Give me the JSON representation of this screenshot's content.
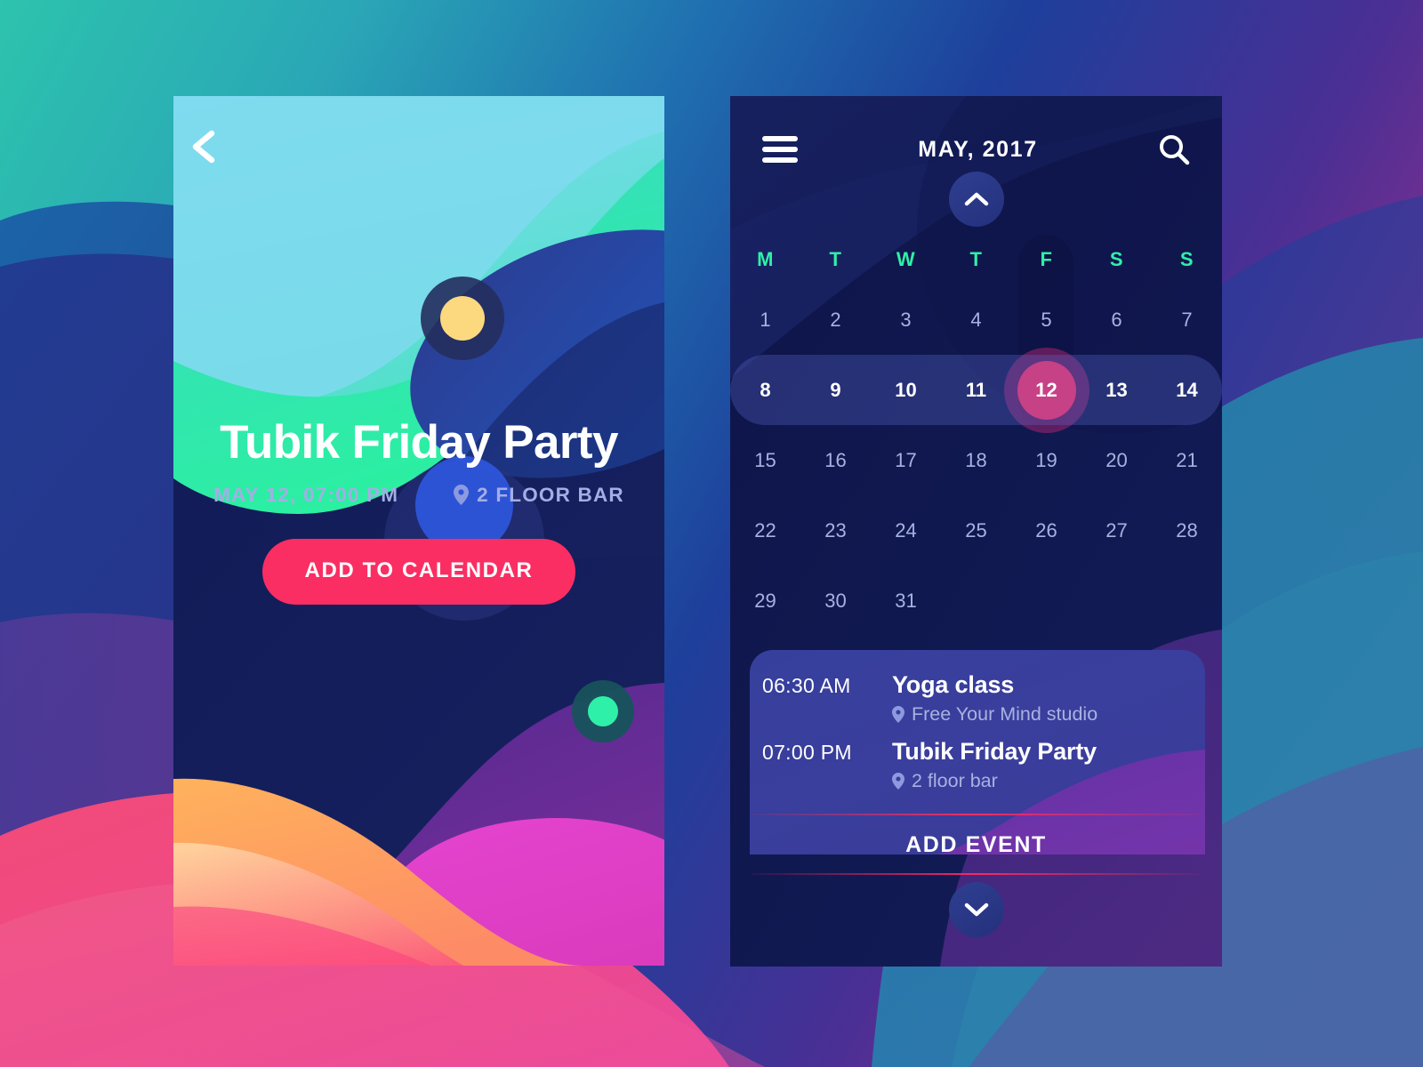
{
  "theme": {
    "accent_pink": "#fa2e63",
    "mint": "#2ff0a8",
    "card_navy": "#141c56",
    "muted_text": "#a8b2e0",
    "panel_blue": "#3a3e9c"
  },
  "event_screen": {
    "back_icon": "chevron-left-icon",
    "title": "Tubik Friday Party",
    "datetime": "MAY 12, 07:00 PM",
    "location_icon": "map-pin-icon",
    "location": "2 FLOOR BAR",
    "cta_label": "ADD TO CALENDAR"
  },
  "calendar_screen": {
    "menu_icon": "hamburger-menu-icon",
    "month_label": "MAY, 2017",
    "search_icon": "search-icon",
    "collapse_icon": "chevron-up-icon",
    "expand_icon": "chevron-down-icon",
    "weekday_headers": [
      "M",
      "T",
      "W",
      "T",
      "F",
      "S",
      "S"
    ],
    "highlighted_weekday_index": 4,
    "weeks": [
      [
        "1",
        "2",
        "3",
        "4",
        "5",
        "6",
        "7"
      ],
      [
        "8",
        "9",
        "10",
        "11",
        "12",
        "13",
        "14"
      ],
      [
        "15",
        "16",
        "17",
        "18",
        "19",
        "20",
        "21"
      ],
      [
        "22",
        "23",
        "24",
        "25",
        "26",
        "27",
        "28"
      ],
      [
        "29",
        "30",
        "31",
        "",
        "",
        "",
        ""
      ]
    ],
    "active_week_index": 1,
    "selected_day": "12",
    "selected_day_col": 4,
    "events": [
      {
        "time": "06:30 AM",
        "name": "Yoga class",
        "place_icon": "map-pin-icon",
        "place": "Free Your Mind studio"
      },
      {
        "time": "07:00 PM",
        "name": "Tubik Friday Party",
        "place_icon": "map-pin-icon",
        "place": "2 floor bar"
      }
    ],
    "add_event_label": "ADD EVENT"
  }
}
